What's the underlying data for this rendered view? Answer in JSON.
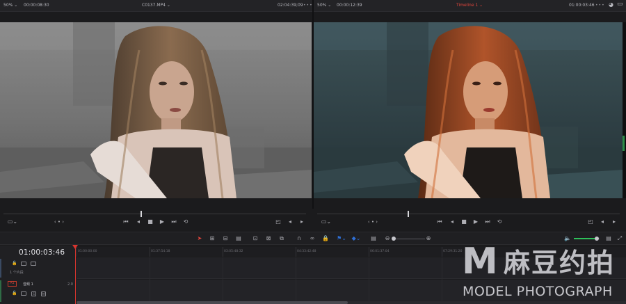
{
  "source_viewer": {
    "zoom": "50%",
    "timecode": "00:00:08:30",
    "clip_name": "C0137.MP4",
    "duration": "02:04:39;09"
  },
  "timeline_viewer": {
    "zoom": "50%",
    "timecode": "00:00:12:39",
    "timeline_name": "Timeline 1",
    "current_timecode": "01:00:03:46"
  },
  "timeline": {
    "current_timecode": "01:00:03:46",
    "ruler_ticks": [
      "01:00:00:00",
      "01:37:54:18",
      "03:05:48:32",
      "04:33:42:48",
      "06:01:37:04",
      "07:29:31:20"
    ],
    "video_track": {
      "name": "1 个片段"
    },
    "audio_track": {
      "id": "A1",
      "name": "音频 1",
      "channel": "2.0"
    }
  },
  "audio": {
    "level": 0.86
  },
  "colors": {
    "accent_red": "#e2453c",
    "audio_green": "#2ec05a",
    "flag_blue": "#2f6fd6"
  },
  "watermark": {
    "letter": "M",
    "brand_cn": "麻豆约拍",
    "brand_en": "MODEL PHOTOGRAPH"
  }
}
